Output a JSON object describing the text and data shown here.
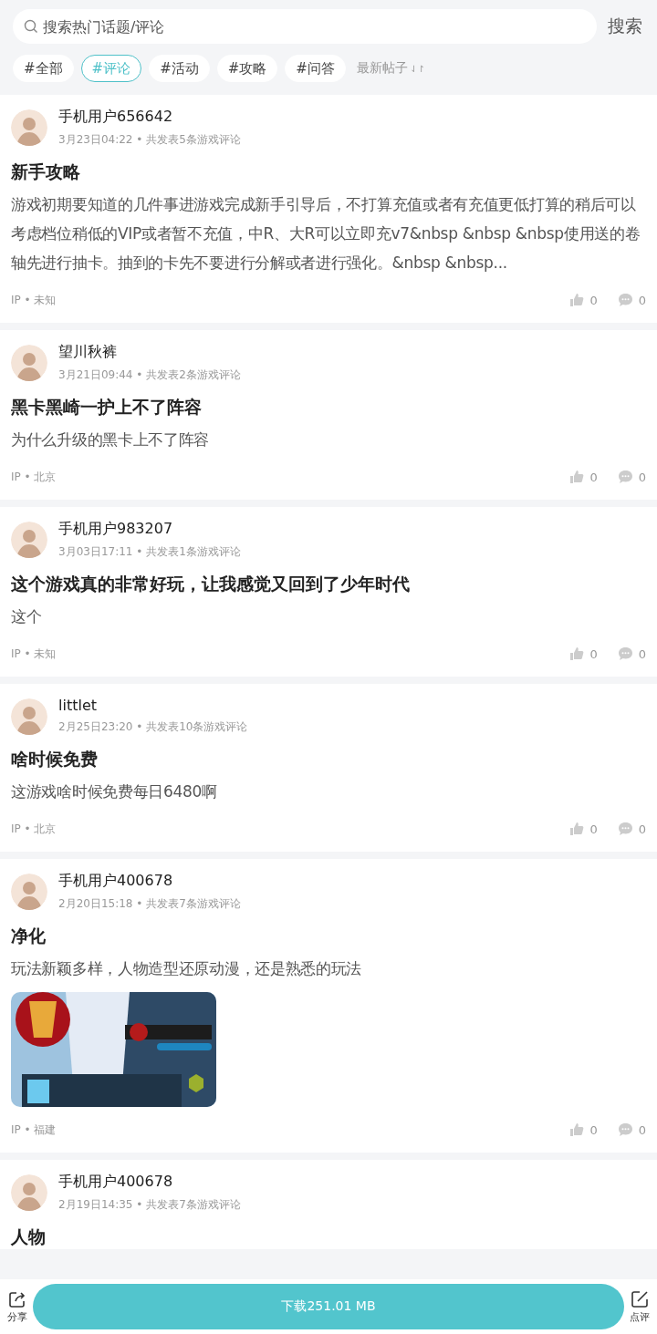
{
  "search": {
    "placeholder": "搜索热门话题/评论",
    "button": "搜索"
  },
  "tags": [
    {
      "label": "#全部",
      "selected": false
    },
    {
      "label": "#评论",
      "selected": true
    },
    {
      "label": "#活动",
      "selected": false
    },
    {
      "label": "#攻略",
      "selected": false
    },
    {
      "label": "#问答",
      "selected": false
    }
  ],
  "sort": {
    "label": "最新帖子",
    "icon": "⇃↾"
  },
  "posts": [
    {
      "user": "手机用户656642",
      "meta": "3月23日04:22 • 共发表5条游戏评论",
      "title": "新手攻略",
      "body": "游戏初期要知道的几件事进游戏完成新手引导后，不打算充值或者有充值更低打算的稍后可以考虑档位稍低的VIP或者暂不充值，中R、大R可以立即充v7&nbsp &nbsp &nbsp使用送的卷轴先进行抽卡。抽到的卡先不要进行分解或者进行强化。&nbsp &nbsp...",
      "ip": "IP • 未知",
      "likes": "0",
      "comments": "0"
    },
    {
      "user": "望川秋裤",
      "meta": "3月21日09:44 • 共发表2条游戏评论",
      "title": "黑卡黑崎一护上不了阵容",
      "body": "为什么升级的黑卡上不了阵容",
      "ip": "IP • 北京",
      "likes": "0",
      "comments": "0"
    },
    {
      "user": "手机用户983207",
      "meta": "3月03日17:11 • 共发表1条游戏评论",
      "title": "这个游戏真的非常好玩，让我感觉又回到了少年时代",
      "body": "这个",
      "ip": "IP • 未知",
      "likes": "0",
      "comments": "0"
    },
    {
      "user": "littlet",
      "meta": "2月25日23:20 • 共发表10条游戏评论",
      "title": "啥时候免费",
      "body": "这游戏啥时候免费每日6480啊",
      "ip": "IP • 北京",
      "likes": "0",
      "comments": "0"
    },
    {
      "user": "手机用户400678",
      "meta": "2月20日15:18 • 共发表7条游戏评论",
      "title": "净化",
      "body": "玩法新颖多样，人物造型还原动漫，还是熟悉的玩法",
      "ip": "IP • 福建",
      "likes": "0",
      "comments": "0"
    },
    {
      "user": "手机用户400678",
      "meta": "2月19日14:35 • 共发表7条游戏评论",
      "title": "人物"
    }
  ],
  "bottom_bar": {
    "share": "分享",
    "download": "下载251.01 MB",
    "review": "点评"
  }
}
